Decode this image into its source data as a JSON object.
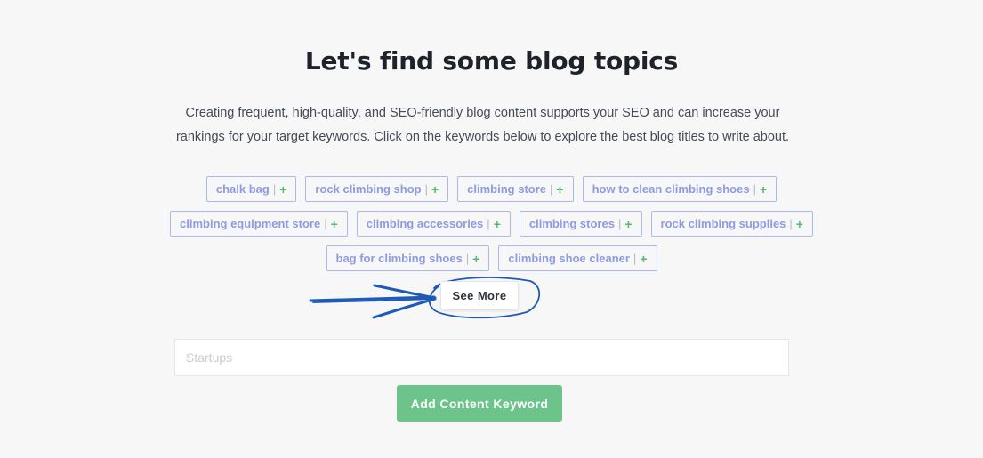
{
  "heading": "Let's find some blog topics",
  "description": "Creating frequent, high-quality, and SEO-friendly blog content supports your SEO and can increase your rankings for your target keywords. Click on the keywords below to explore the best blog titles to write about.",
  "chip_separator": "|",
  "chip_add_symbol": "+",
  "keyword_rows": [
    [
      "chalk bag",
      "rock climbing shop",
      "climbing store",
      "how to clean climbing shoes"
    ],
    [
      "climbing equipment store",
      "climbing accessories",
      "climbing stores",
      "rock climbing supplies"
    ],
    [
      "bag for climbing shoes",
      "climbing shoe cleaner"
    ]
  ],
  "see_more_label": "See More",
  "keyword_input": {
    "placeholder": "Startups",
    "value": ""
  },
  "add_button_label": "Add Content Keyword",
  "colors": {
    "chip_text": "#8e9be0",
    "chip_border": "#aeb8e8",
    "plus_green": "#58b970",
    "button_green": "#6cc48a",
    "annotation_blue": "#1e5bb8"
  }
}
